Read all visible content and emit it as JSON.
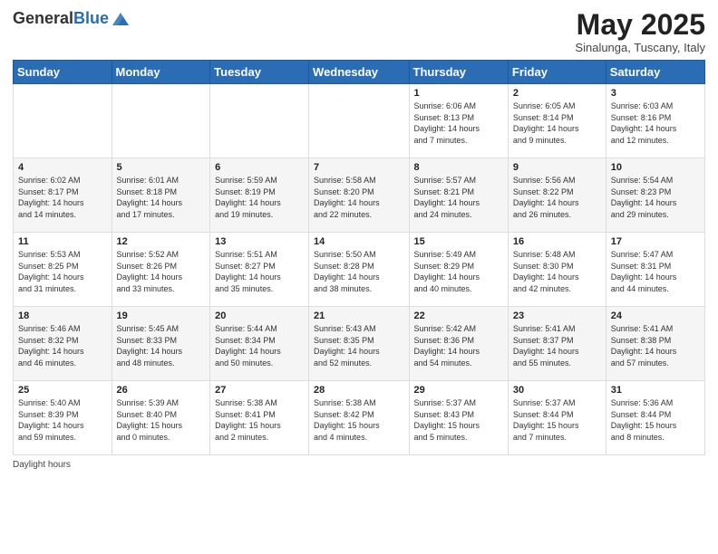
{
  "header": {
    "logo_general": "General",
    "logo_blue": "Blue",
    "month_title": "May 2025",
    "subtitle": "Sinalunga, Tuscany, Italy"
  },
  "weekdays": [
    "Sunday",
    "Monday",
    "Tuesday",
    "Wednesday",
    "Thursday",
    "Friday",
    "Saturday"
  ],
  "weeks": [
    [
      {
        "day": "",
        "info": ""
      },
      {
        "day": "",
        "info": ""
      },
      {
        "day": "",
        "info": ""
      },
      {
        "day": "",
        "info": ""
      },
      {
        "day": "1",
        "info": "Sunrise: 6:06 AM\nSunset: 8:13 PM\nDaylight: 14 hours\nand 7 minutes."
      },
      {
        "day": "2",
        "info": "Sunrise: 6:05 AM\nSunset: 8:14 PM\nDaylight: 14 hours\nand 9 minutes."
      },
      {
        "day": "3",
        "info": "Sunrise: 6:03 AM\nSunset: 8:16 PM\nDaylight: 14 hours\nand 12 minutes."
      }
    ],
    [
      {
        "day": "4",
        "info": "Sunrise: 6:02 AM\nSunset: 8:17 PM\nDaylight: 14 hours\nand 14 minutes."
      },
      {
        "day": "5",
        "info": "Sunrise: 6:01 AM\nSunset: 8:18 PM\nDaylight: 14 hours\nand 17 minutes."
      },
      {
        "day": "6",
        "info": "Sunrise: 5:59 AM\nSunset: 8:19 PM\nDaylight: 14 hours\nand 19 minutes."
      },
      {
        "day": "7",
        "info": "Sunrise: 5:58 AM\nSunset: 8:20 PM\nDaylight: 14 hours\nand 22 minutes."
      },
      {
        "day": "8",
        "info": "Sunrise: 5:57 AM\nSunset: 8:21 PM\nDaylight: 14 hours\nand 24 minutes."
      },
      {
        "day": "9",
        "info": "Sunrise: 5:56 AM\nSunset: 8:22 PM\nDaylight: 14 hours\nand 26 minutes."
      },
      {
        "day": "10",
        "info": "Sunrise: 5:54 AM\nSunset: 8:23 PM\nDaylight: 14 hours\nand 29 minutes."
      }
    ],
    [
      {
        "day": "11",
        "info": "Sunrise: 5:53 AM\nSunset: 8:25 PM\nDaylight: 14 hours\nand 31 minutes."
      },
      {
        "day": "12",
        "info": "Sunrise: 5:52 AM\nSunset: 8:26 PM\nDaylight: 14 hours\nand 33 minutes."
      },
      {
        "day": "13",
        "info": "Sunrise: 5:51 AM\nSunset: 8:27 PM\nDaylight: 14 hours\nand 35 minutes."
      },
      {
        "day": "14",
        "info": "Sunrise: 5:50 AM\nSunset: 8:28 PM\nDaylight: 14 hours\nand 38 minutes."
      },
      {
        "day": "15",
        "info": "Sunrise: 5:49 AM\nSunset: 8:29 PM\nDaylight: 14 hours\nand 40 minutes."
      },
      {
        "day": "16",
        "info": "Sunrise: 5:48 AM\nSunset: 8:30 PM\nDaylight: 14 hours\nand 42 minutes."
      },
      {
        "day": "17",
        "info": "Sunrise: 5:47 AM\nSunset: 8:31 PM\nDaylight: 14 hours\nand 44 minutes."
      }
    ],
    [
      {
        "day": "18",
        "info": "Sunrise: 5:46 AM\nSunset: 8:32 PM\nDaylight: 14 hours\nand 46 minutes."
      },
      {
        "day": "19",
        "info": "Sunrise: 5:45 AM\nSunset: 8:33 PM\nDaylight: 14 hours\nand 48 minutes."
      },
      {
        "day": "20",
        "info": "Sunrise: 5:44 AM\nSunset: 8:34 PM\nDaylight: 14 hours\nand 50 minutes."
      },
      {
        "day": "21",
        "info": "Sunrise: 5:43 AM\nSunset: 8:35 PM\nDaylight: 14 hours\nand 52 minutes."
      },
      {
        "day": "22",
        "info": "Sunrise: 5:42 AM\nSunset: 8:36 PM\nDaylight: 14 hours\nand 54 minutes."
      },
      {
        "day": "23",
        "info": "Sunrise: 5:41 AM\nSunset: 8:37 PM\nDaylight: 14 hours\nand 55 minutes."
      },
      {
        "day": "24",
        "info": "Sunrise: 5:41 AM\nSunset: 8:38 PM\nDaylight: 14 hours\nand 57 minutes."
      }
    ],
    [
      {
        "day": "25",
        "info": "Sunrise: 5:40 AM\nSunset: 8:39 PM\nDaylight: 14 hours\nand 59 minutes."
      },
      {
        "day": "26",
        "info": "Sunrise: 5:39 AM\nSunset: 8:40 PM\nDaylight: 15 hours\nand 0 minutes."
      },
      {
        "day": "27",
        "info": "Sunrise: 5:38 AM\nSunset: 8:41 PM\nDaylight: 15 hours\nand 2 minutes."
      },
      {
        "day": "28",
        "info": "Sunrise: 5:38 AM\nSunset: 8:42 PM\nDaylight: 15 hours\nand 4 minutes."
      },
      {
        "day": "29",
        "info": "Sunrise: 5:37 AM\nSunset: 8:43 PM\nDaylight: 15 hours\nand 5 minutes."
      },
      {
        "day": "30",
        "info": "Sunrise: 5:37 AM\nSunset: 8:44 PM\nDaylight: 15 hours\nand 7 minutes."
      },
      {
        "day": "31",
        "info": "Sunrise: 5:36 AM\nSunset: 8:44 PM\nDaylight: 15 hours\nand 8 minutes."
      }
    ]
  ],
  "footer": {
    "daylight_label": "Daylight hours"
  }
}
